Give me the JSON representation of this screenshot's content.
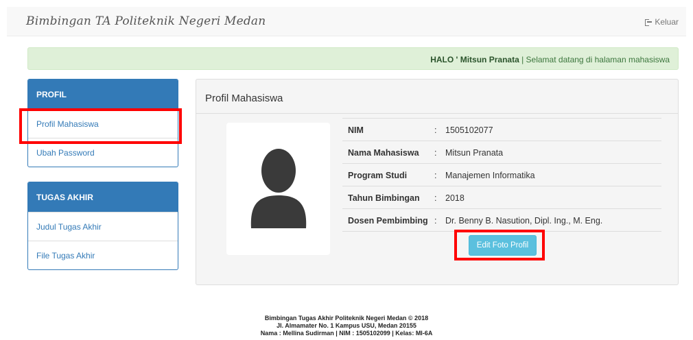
{
  "navbar": {
    "brand": "Bimbingan TA Politeknik Negeri Medan",
    "logout_label": "Keluar",
    "logout_icon": "sign-out-icon"
  },
  "alert": {
    "greeting": "HALO ' Mitsun Pranata",
    "message": " | Selamat datang di halaman mahasiswa",
    "color": "#dff0d8"
  },
  "sidebar": {
    "profil": {
      "heading": "PROFIL",
      "items": [
        {
          "label": "Profil Mahasiswa"
        },
        {
          "label": "Ubah Password"
        }
      ]
    },
    "tugas_akhir": {
      "heading": "TUGAS AKHIR",
      "items": [
        {
          "label": "Judul Tugas Akhir"
        },
        {
          "label": "File Tugas Akhir"
        }
      ]
    },
    "accent_color": "#337ab7"
  },
  "main": {
    "title": "Profil Mahasiswa",
    "avatar_icon": "user-silhouette-icon",
    "fields": [
      {
        "label": "NIM",
        "sep": ":",
        "value": "1505102077"
      },
      {
        "label": "Nama Mahasiswa",
        "sep": ":",
        "value": "Mitsun Pranata"
      },
      {
        "label": "Program Studi",
        "sep": ":",
        "value": "Manajemen Informatika"
      },
      {
        "label": "Tahun Bimbingan",
        "sep": ":",
        "value": "2018"
      },
      {
        "label": "Dosen Pembimbing",
        "sep": ":",
        "value": "Dr. Benny B. Nasution, Dipl. Ing., M. Eng."
      }
    ],
    "edit_button": "Edit Foto Profil"
  },
  "footer": {
    "line1": "Bimbingan Tugas Akhir Politeknik Negeri Medan © 2018",
    "line2": "Jl. Almamater No. 1 Kampus USU, Medan 20155",
    "line3": "Nama : Mellina Sudirman | NIM : 1505102099 | Kelas: MI-6A"
  },
  "highlight_color": "#ff0000"
}
